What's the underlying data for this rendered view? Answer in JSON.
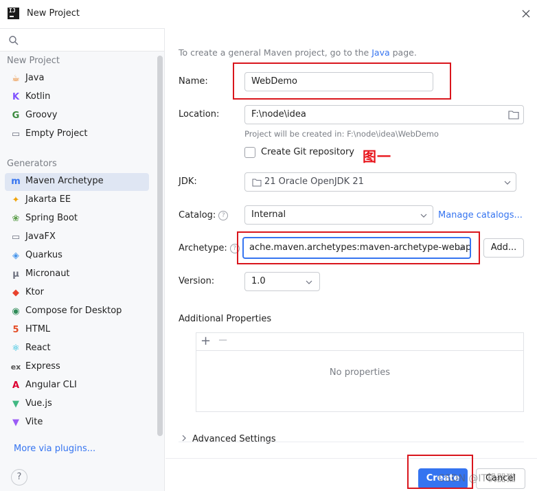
{
  "window": {
    "title": "New Project",
    "logo_text": "IJ"
  },
  "sidebar": {
    "search_placeholder": "",
    "new_project_header": "New Project",
    "new_project_items": [
      {
        "label": "Java",
        "icon": "java-cup-icon",
        "color": "#e76f00",
        "glyph": "☕"
      },
      {
        "label": "Kotlin",
        "icon": "kotlin-icon",
        "color": "#7f52ff",
        "glyph": "K"
      },
      {
        "label": "Groovy",
        "icon": "groovy-icon",
        "color": "#3b8a3e",
        "glyph": "G"
      },
      {
        "label": "Empty Project",
        "icon": "folder-icon",
        "color": "#6c707e",
        "glyph": "▭"
      }
    ],
    "generators_header": "Generators",
    "generator_items": [
      {
        "label": "Maven Archetype",
        "icon": "maven-icon",
        "color": "#3574f0",
        "glyph": "m",
        "selected": true
      },
      {
        "label": "Jakarta EE",
        "icon": "jakarta-ee-icon",
        "color": "#f0a30a",
        "glyph": "✦"
      },
      {
        "label": "Spring Boot",
        "icon": "spring-boot-icon",
        "color": "#5fa04e",
        "glyph": "❀"
      },
      {
        "label": "JavaFX",
        "icon": "javafx-icon",
        "color": "#6c707e",
        "glyph": "▭"
      },
      {
        "label": "Quarkus",
        "icon": "quarkus-icon",
        "color": "#4695eb",
        "glyph": "◈"
      },
      {
        "label": "Micronaut",
        "icon": "micronaut-icon",
        "color": "#6c707e",
        "glyph": "μ"
      },
      {
        "label": "Ktor",
        "icon": "ktor-icon",
        "color": "#e8432e",
        "glyph": "◆"
      },
      {
        "label": "Compose for Desktop",
        "icon": "compose-icon",
        "color": "#2e8b57",
        "glyph": "◉"
      },
      {
        "label": "HTML",
        "icon": "html5-icon",
        "color": "#e44d26",
        "glyph": "5"
      },
      {
        "label": "React",
        "icon": "react-icon",
        "color": "#00b4d8",
        "glyph": "⚛"
      },
      {
        "label": "Express",
        "icon": "express-icon",
        "color": "#555555",
        "glyph": "ex"
      },
      {
        "label": "Angular CLI",
        "icon": "angular-icon",
        "color": "#dd0031",
        "glyph": "A"
      },
      {
        "label": "Vue.js",
        "icon": "vue-icon",
        "color": "#41b883",
        "glyph": "▼"
      },
      {
        "label": "Vite",
        "icon": "vite-icon",
        "color": "#9b5cf6",
        "glyph": "▼"
      }
    ],
    "more_plugins": "More via plugins...",
    "help": "?"
  },
  "main": {
    "hint_prefix": "To create a general Maven project, go to the ",
    "hint_link": "Java",
    "hint_suffix": " page.",
    "name_label": "Name:",
    "name_value": "WebDemo",
    "location_label": "Location:",
    "location_value": "F:\\node\\idea",
    "location_note": "Project will be created in: F:\\node\\idea\\WebDemo",
    "git_label": "Create Git repository",
    "annotation": "图一",
    "jdk_label": "JDK:",
    "jdk_value": "21 Oracle OpenJDK 21",
    "catalog_label": "Catalog:",
    "catalog_value": "Internal",
    "manage_catalogs": "Manage catalogs...",
    "archetype_label": "Archetype:",
    "archetype_value": "ache.maven.archetypes:maven-archetype-webapp",
    "add_button": "Add...",
    "version_label": "Version:",
    "version_value": "1.0",
    "additional_title": "Additional Properties",
    "add_prop": "+",
    "remove_prop": "−",
    "no_properties": "No properties",
    "advanced": "Advanced Settings",
    "create_button": "Create",
    "cancel_button": "Cancel",
    "watermark": "CSDN @IT机器猫",
    "accent": "#3574f0",
    "annotation_color": "#d9151c"
  }
}
